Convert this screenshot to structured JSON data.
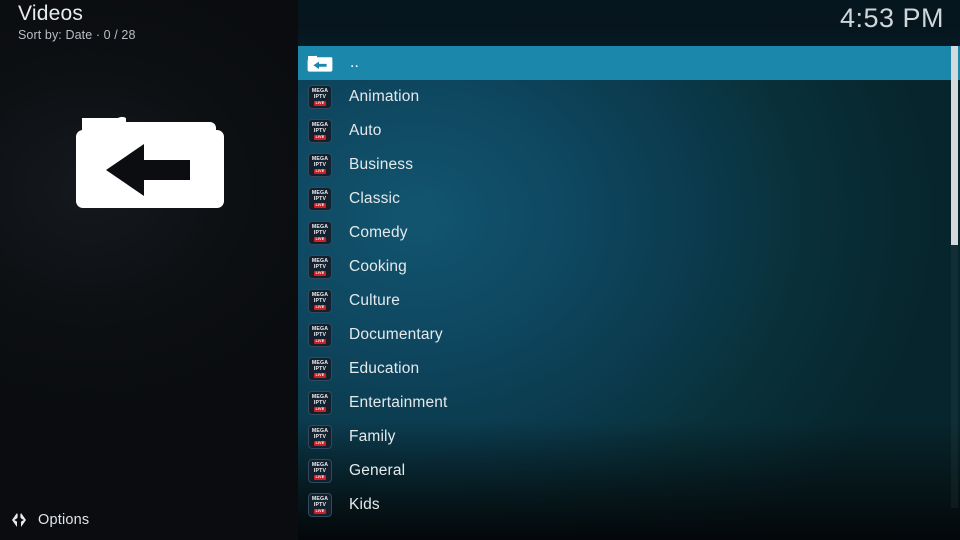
{
  "header": {
    "title": "Videos",
    "subtitle": "Sort by: Date  ·  0 / 28",
    "clock": "4:53 PM"
  },
  "left_panel": {
    "artwork_icon": "parent-folder-icon"
  },
  "options": {
    "label": "Options",
    "icon": "left-right-arrows-icon"
  },
  "list": {
    "thumbnail": {
      "line1": "MEGA",
      "line2": "IPTV",
      "badge": "LIVE"
    },
    "items": [
      {
        "label": "..",
        "icon": "parent-folder-icon",
        "selected": true
      },
      {
        "label": "Animation",
        "icon": "mega-iptv-thumbnail",
        "selected": false
      },
      {
        "label": "Auto",
        "icon": "mega-iptv-thumbnail",
        "selected": false
      },
      {
        "label": "Business",
        "icon": "mega-iptv-thumbnail",
        "selected": false
      },
      {
        "label": "Classic",
        "icon": "mega-iptv-thumbnail",
        "selected": false
      },
      {
        "label": "Comedy",
        "icon": "mega-iptv-thumbnail",
        "selected": false
      },
      {
        "label": "Cooking",
        "icon": "mega-iptv-thumbnail",
        "selected": false
      },
      {
        "label": "Culture",
        "icon": "mega-iptv-thumbnail",
        "selected": false
      },
      {
        "label": "Documentary",
        "icon": "mega-iptv-thumbnail",
        "selected": false
      },
      {
        "label": "Education",
        "icon": "mega-iptv-thumbnail",
        "selected": false
      },
      {
        "label": "Entertainment",
        "icon": "mega-iptv-thumbnail",
        "selected": false
      },
      {
        "label": "Family",
        "icon": "mega-iptv-thumbnail",
        "selected": false
      },
      {
        "label": "General",
        "icon": "mega-iptv-thumbnail",
        "selected": false
      },
      {
        "label": "Kids",
        "icon": "mega-iptv-thumbnail",
        "selected": false
      }
    ]
  },
  "colors": {
    "highlight": "#1b87ab",
    "panel_teal": "#0e465f",
    "left_panel": "#0d1013",
    "badge_red": "#cf2027",
    "text": "#e4e9ec"
  }
}
